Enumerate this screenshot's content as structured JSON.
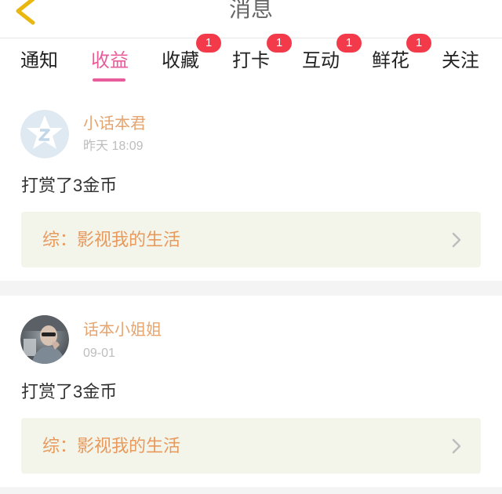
{
  "header": {
    "title": "消息",
    "back_icon": "chevron-left-icon"
  },
  "tabs": [
    {
      "label": "通知"
    },
    {
      "label": "收益",
      "active": true
    },
    {
      "label": "收藏",
      "badge": "1"
    },
    {
      "label": "打卡",
      "badge": "1"
    },
    {
      "label": "互动",
      "badge": "1"
    },
    {
      "label": "鲜花",
      "badge": "1"
    },
    {
      "label": "关注"
    }
  ],
  "messages": [
    {
      "avatar_icon": "qq-star-avatar",
      "name": "小话本君",
      "time": "昨天 18:09",
      "action": "打赏了3金币",
      "work": "综：影视我的生活",
      "work_icon": "chevron-right-icon"
    },
    {
      "avatar_icon": "photo-avatar",
      "name": "话本小姐姐",
      "time": "09-01",
      "action": "打赏了3金币",
      "work": "综：影视我的生活",
      "work_icon": "chevron-right-icon"
    }
  ],
  "colors": {
    "accent_pink": "#e95c9c",
    "name_orange": "#e6a46f",
    "work_orange": "#e8995b",
    "badge_red": "#f23a4b",
    "back_gold": "#e9b70f"
  }
}
